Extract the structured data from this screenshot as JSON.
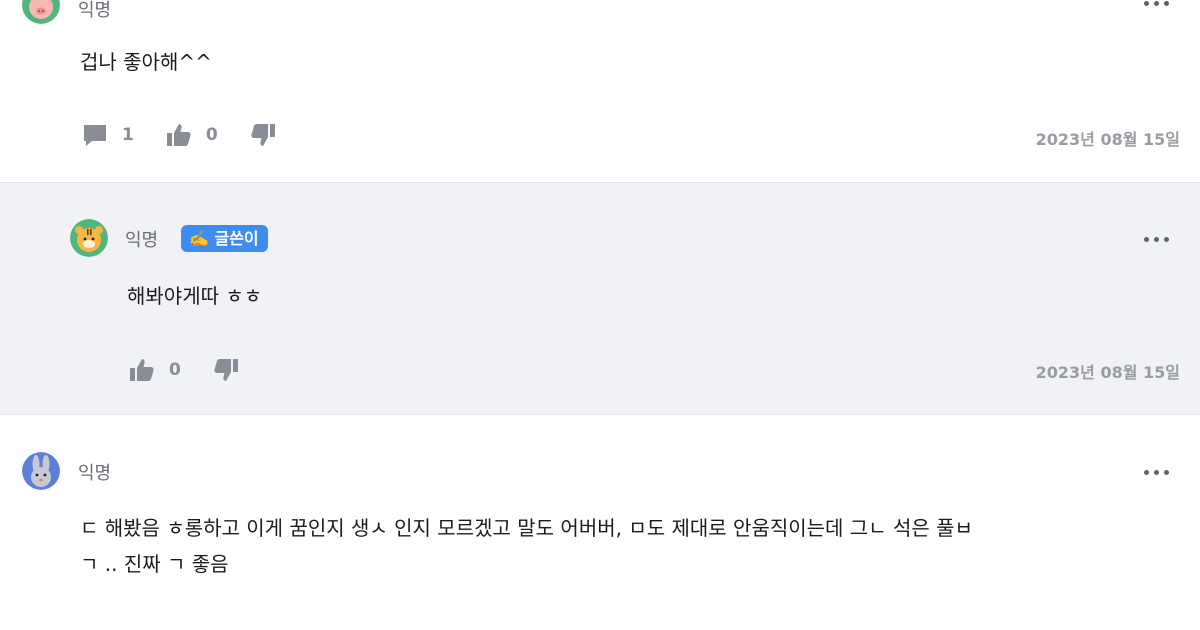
{
  "comments": [
    {
      "author": "익명",
      "text": "겁나 좋아해^^",
      "reply_count": "1",
      "like_count": "0",
      "date": "2023년 08월 15일",
      "avatar": "pig-avatar"
    },
    {
      "author": "익명",
      "badge": "✍️ 글쓴이",
      "text": "해봐야게따 ㅎㅎ",
      "like_count": "0",
      "date": "2023년 08월 15일",
      "avatar": "tiger-avatar"
    },
    {
      "author": "익명",
      "text_line1": "ㄷ 해봤음 ㅎ롱하고 이게 꿈인지 생ㅅ 인지 모르겠고 말도 어버버, ㅁ도 제대로 안움직이는데 그ㄴ 석은 풀ㅂ",
      "text_line2": "ㄱ .. 진짜 ㄱ 좋음",
      "avatar": "rabbit-avatar"
    }
  ],
  "colors": {
    "badge_bg": "#3f8cf0",
    "reply_bg": "#f1f2f6",
    "icon": "#8a8d96"
  },
  "icons": [
    "comment-icon",
    "thumbs-up-icon",
    "thumbs-down-icon",
    "more-icon"
  ]
}
